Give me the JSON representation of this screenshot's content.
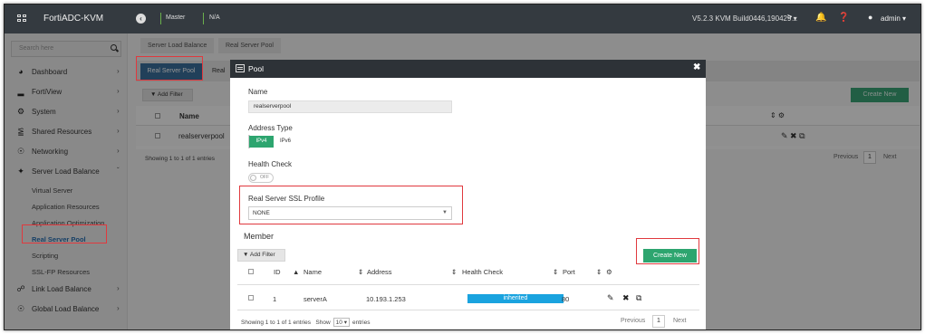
{
  "topbar": {
    "app_name": "FortiADC-KVM",
    "master": "Master",
    "na": "N/A",
    "version": "V5.2.3 KVM Build0446,190429 ▾",
    "admin": "admin ▾",
    "icons": [
      "grid-icon",
      "back-icon",
      "terminal-icon",
      "bell-icon",
      "help-icon",
      "user-icon"
    ]
  },
  "sidebar": {
    "search_placeholder": "Search here",
    "items": [
      {
        "label": "Dashboard",
        "icon": "dashboard-icon"
      },
      {
        "label": "FortiView",
        "icon": "chart-icon"
      },
      {
        "label": "System",
        "icon": "gear-icon"
      },
      {
        "label": "Shared Resources",
        "icon": "share-icon"
      },
      {
        "label": "Networking",
        "icon": "globe-icon"
      },
      {
        "label": "Server Load Balance",
        "icon": "balance-icon"
      }
    ],
    "sub_items": [
      "Virtual Server",
      "Application Resources",
      "Application Optimization",
      "Real Server Pool",
      "Scripting",
      "SSL-FP Resources"
    ],
    "bottom_items": [
      {
        "label": "Link Load Balance",
        "icon": "link-icon"
      },
      {
        "label": "Global Load Balance",
        "icon": "globe-icon"
      }
    ]
  },
  "breadcrumb": [
    "Server Load Balance",
    "Real Server Pool"
  ],
  "tabs": {
    "active": "Real Server Pool",
    "second": "Real"
  },
  "background": {
    "add_filter": "Add Filter",
    "create_new": "Create New",
    "col_name": "Name",
    "row_name": "realserverpool",
    "showing": "Showing 1 to 1 of 1 entries",
    "previous": "Previous",
    "page": "1",
    "next": "Next"
  },
  "modal": {
    "title": "Pool",
    "name_label": "Name",
    "name_value": "realserverpool",
    "address_type_label": "Address Type",
    "ipv4": "IPv4",
    "ipv6": "IPv6",
    "health_check_label": "Health Check",
    "toggle_text": "OFF",
    "ssl_profile_label": "Real Server SSL Profile",
    "ssl_profile_value": "NONE",
    "member_label": "Member",
    "add_filter": "Add Filter",
    "create_new": "Create New",
    "columns": {
      "id": "ID",
      "name": "Name",
      "address": "Address",
      "health": "Health Check",
      "port": "Port"
    },
    "row": {
      "id": "1",
      "name": "serverA",
      "address": "10.193.1.253",
      "health": "inherited",
      "port": "80"
    },
    "showing": "Showing 1 to 1 of 1 entries",
    "show": "Show",
    "page_size": "10 ▾",
    "entries": "entries",
    "previous": "Previous",
    "page": "1",
    "next": "Next"
  },
  "colors": {
    "topbar": "#343a40",
    "accent_green": "#2da56f",
    "tab_blue": "#3a6f9b",
    "health_blue": "#1aa3df",
    "highlight_red": "#e0393e"
  }
}
